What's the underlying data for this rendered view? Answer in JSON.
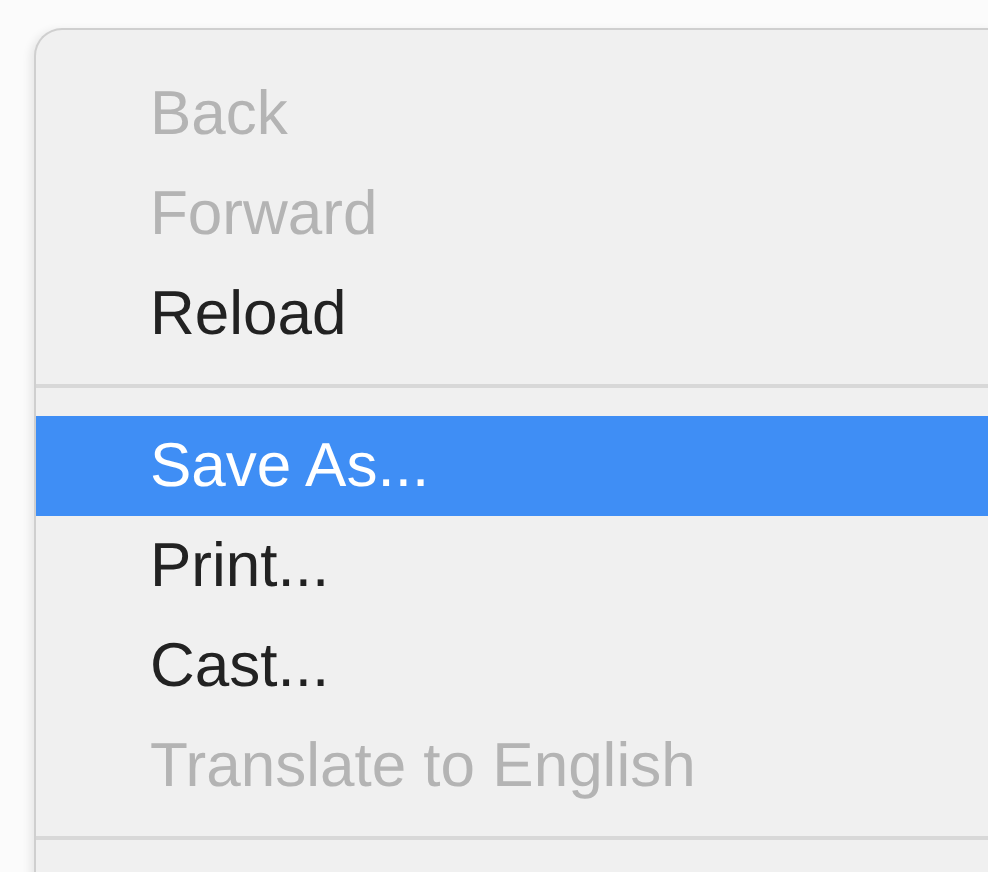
{
  "menu": {
    "entries": [
      {
        "kind": "item",
        "label": "Back",
        "disabled": true,
        "selected": false
      },
      {
        "kind": "item",
        "label": "Forward",
        "disabled": true,
        "selected": false
      },
      {
        "kind": "item",
        "label": "Reload",
        "disabled": false,
        "selected": false
      },
      {
        "kind": "separator"
      },
      {
        "kind": "item",
        "label": "Save As...",
        "disabled": false,
        "selected": true
      },
      {
        "kind": "item",
        "label": "Print...",
        "disabled": false,
        "selected": false
      },
      {
        "kind": "item",
        "label": "Cast...",
        "disabled": false,
        "selected": false
      },
      {
        "kind": "item",
        "label": "Translate to English",
        "disabled": true,
        "selected": false
      },
      {
        "kind": "separator"
      }
    ]
  }
}
